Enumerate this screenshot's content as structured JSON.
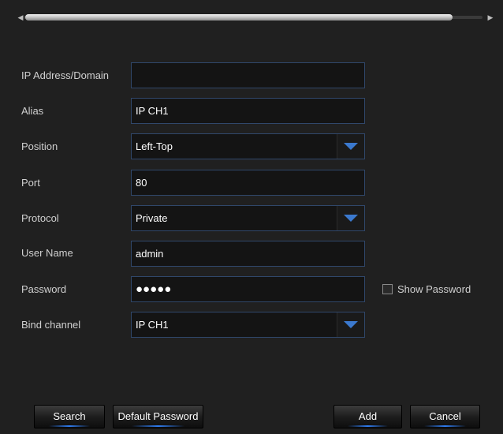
{
  "scrollbar": {
    "left_arrow": "◀",
    "right_arrow": "▶"
  },
  "form": {
    "ip_address": {
      "label": "IP Address/Domain",
      "value": ""
    },
    "alias": {
      "label": "Alias",
      "value": "IP CH1"
    },
    "position": {
      "label": "Position",
      "value": "Left-Top"
    },
    "port": {
      "label": "Port",
      "value": "80"
    },
    "protocol": {
      "label": "Protocol",
      "value": "Private"
    },
    "user_name": {
      "label": "User Name",
      "value": "admin"
    },
    "password": {
      "label": "Password",
      "value": "●●●●●"
    },
    "bind_channel": {
      "label": "Bind channel",
      "value": "IP CH1"
    },
    "show_password": {
      "label": "Show Password",
      "checked": false
    }
  },
  "buttons": {
    "search": "Search",
    "default_password": "Default Password",
    "add": "Add",
    "cancel": "Cancel"
  },
  "colors": {
    "background": "#202020",
    "field_border": "#30476a",
    "dropdown_arrow": "#3b79ce",
    "button_glow": "#2f7cf0"
  }
}
